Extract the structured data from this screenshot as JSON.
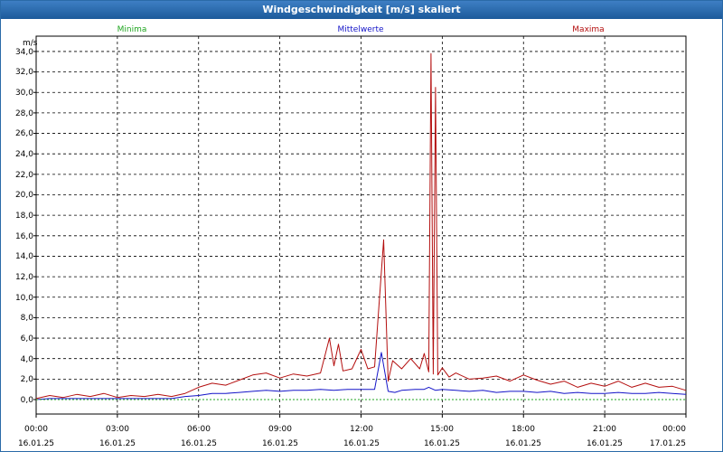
{
  "window": {
    "title": "Windgeschwindigkeit [m/s] skaliert"
  },
  "chart_data": {
    "type": "line",
    "title": "Windgeschwindigkeit [m/s] skaliert",
    "ylabel": "m/s",
    "xlabel": "",
    "ylim": [
      0,
      35
    ],
    "xlim": [
      "16.01.25 00:00",
      "17.01.25 00:00"
    ],
    "grid": true,
    "legend_position": "top",
    "y_ticks": [
      "0,0",
      "2,0",
      "4,0",
      "6,0",
      "8,0",
      "10,0",
      "12,0",
      "14,0",
      "16,0",
      "18,0",
      "20,0",
      "22,0",
      "24,0",
      "26,0",
      "28,0",
      "30,0",
      "32,0",
      "34,0"
    ],
    "x_ticks": [
      {
        "time": "00:00",
        "date": "16.01.25"
      },
      {
        "time": "03:00",
        "date": "16.01.25"
      },
      {
        "time": "06:00",
        "date": "16.01.25"
      },
      {
        "time": "09:00",
        "date": "16.01.25"
      },
      {
        "time": "12:00",
        "date": "16.01.25"
      },
      {
        "time": "15:00",
        "date": "16.01.25"
      },
      {
        "time": "18:00",
        "date": "16.01.25"
      },
      {
        "time": "21:00",
        "date": "16.01.25"
      },
      {
        "time": "00:00",
        "date": "17.01.25"
      }
    ],
    "series": [
      {
        "name": "Minima",
        "color": "#1fa51f",
        "x": [
          "16.01.25 00:00",
          "17.01.25 00:00"
        ],
        "values": [
          0.0,
          0.0
        ]
      },
      {
        "name": "Mittelwerte",
        "color": "#1414c8",
        "x": [
          "16.01.25 00:00",
          "16.01.25 00:30",
          "16.01.25 01:00",
          "16.01.25 01:30",
          "16.01.25 02:00",
          "16.01.25 02:30",
          "16.01.25 03:00",
          "16.01.25 03:30",
          "16.01.25 04:00",
          "16.01.25 04:30",
          "16.01.25 05:00",
          "16.01.25 05:30",
          "16.01.25 06:00",
          "16.01.25 06:30",
          "16.01.25 07:00",
          "16.01.25 07:30",
          "16.01.25 08:00",
          "16.01.25 08:30",
          "16.01.25 09:00",
          "16.01.25 09:30",
          "16.01.25 10:00",
          "16.01.25 10:30",
          "16.01.25 11:00",
          "16.01.25 11:30",
          "16.01.25 12:00",
          "16.01.25 12:30",
          "16.01.25 12:45",
          "16.01.25 13:00",
          "16.01.25 13:15",
          "16.01.25 13:30",
          "16.01.25 14:00",
          "16.01.25 14:20",
          "16.01.25 14:30",
          "16.01.25 14:45",
          "16.01.25 15:00",
          "16.01.25 15:30",
          "16.01.25 16:00",
          "16.01.25 16:30",
          "16.01.25 17:00",
          "16.01.25 17:30",
          "16.01.25 18:00",
          "16.01.25 18:30",
          "16.01.25 19:00",
          "16.01.25 19:30",
          "16.01.25 20:00",
          "16.01.25 20:30",
          "16.01.25 21:00",
          "16.01.25 21:30",
          "16.01.25 22:00",
          "16.01.25 22:30",
          "16.01.25 23:00",
          "16.01.25 23:30",
          "17.01.25 00:00"
        ],
        "values": [
          0.0,
          0.1,
          0.1,
          0.1,
          0.1,
          0.1,
          0.1,
          0.1,
          0.1,
          0.1,
          0.1,
          0.3,
          0.4,
          0.6,
          0.6,
          0.7,
          0.8,
          0.9,
          0.8,
          0.9,
          0.9,
          1.0,
          0.9,
          1.0,
          1.0,
          1.0,
          4.6,
          0.8,
          0.7,
          0.9,
          1.0,
          1.0,
          1.2,
          0.9,
          1.0,
          0.9,
          0.8,
          0.9,
          0.7,
          0.8,
          0.8,
          0.7,
          0.8,
          0.6,
          0.7,
          0.6,
          0.6,
          0.7,
          0.6,
          0.6,
          0.7,
          0.6,
          0.5
        ]
      },
      {
        "name": "Maxima",
        "color": "#b40f0f",
        "x": [
          "16.01.25 00:00",
          "16.01.25 00:30",
          "16.01.25 01:00",
          "16.01.25 01:30",
          "16.01.25 02:00",
          "16.01.25 02:30",
          "16.01.25 03:00",
          "16.01.25 03:30",
          "16.01.25 04:00",
          "16.01.25 04:30",
          "16.01.25 05:00",
          "16.01.25 05:30",
          "16.01.25 06:00",
          "16.01.25 06:30",
          "16.01.25 07:00",
          "16.01.25 07:30",
          "16.01.25 08:00",
          "16.01.25 08:30",
          "16.01.25 09:00",
          "16.01.25 09:30",
          "16.01.25 10:00",
          "16.01.25 10:30",
          "16.01.25 10:50",
          "16.01.25 11:00",
          "16.01.25 11:10",
          "16.01.25 11:20",
          "16.01.25 11:40",
          "16.01.25 12:00",
          "16.01.25 12:15",
          "16.01.25 12:30",
          "16.01.25 12:50",
          "16.01.25 13:00",
          "16.01.25 13:10",
          "16.01.25 13:30",
          "16.01.25 13:50",
          "16.01.25 14:10",
          "16.01.25 14:20",
          "16.01.25 14:30",
          "16.01.25 14:35",
          "16.01.25 14:40",
          "16.01.25 14:45",
          "16.01.25 14:50",
          "16.01.25 15:00",
          "16.01.25 15:15",
          "16.01.25 15:30",
          "16.01.25 16:00",
          "16.01.25 16:30",
          "16.01.25 17:00",
          "16.01.25 17:30",
          "16.01.25 18:00",
          "16.01.25 18:30",
          "16.01.25 19:00",
          "16.01.25 19:30",
          "16.01.25 20:00",
          "16.01.25 20:30",
          "16.01.25 21:00",
          "16.01.25 21:30",
          "16.01.25 22:00",
          "16.01.25 22:30",
          "16.01.25 23:00",
          "16.01.25 23:30",
          "17.01.25 00:00"
        ],
        "values": [
          0.1,
          0.4,
          0.2,
          0.5,
          0.3,
          0.6,
          0.2,
          0.4,
          0.3,
          0.5,
          0.3,
          0.6,
          1.2,
          1.6,
          1.4,
          1.9,
          2.4,
          2.6,
          2.1,
          2.5,
          2.3,
          2.6,
          6.0,
          3.3,
          5.4,
          2.8,
          3.0,
          4.9,
          3.0,
          3.2,
          15.6,
          1.8,
          3.8,
          3.0,
          4.0,
          3.0,
          4.5,
          2.7,
          33.8,
          2.5,
          30.5,
          2.4,
          3.1,
          2.2,
          2.6,
          2.0,
          2.1,
          2.3,
          1.8,
          2.4,
          1.9,
          1.5,
          1.8,
          1.2,
          1.6,
          1.3,
          1.8,
          1.2,
          1.6,
          1.2,
          1.3,
          0.9
        ]
      }
    ]
  }
}
